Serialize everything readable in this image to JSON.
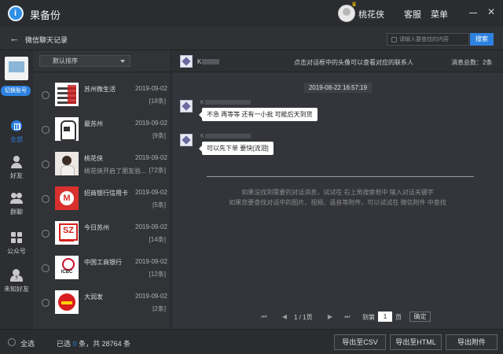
{
  "app": {
    "title": "果备份",
    "logo_glyph": "i",
    "accent": "#2d82e0"
  },
  "titlebar": {
    "user_name": "桃花侠",
    "service": "客服",
    "menu": "菜单",
    "minimize_glyph": "—",
    "close_glyph": "✕",
    "crown_glyph": "♛"
  },
  "subbar": {
    "back_glyph": "←",
    "title": "微信聊天记录",
    "search_placeholder": "请输入要查找的内容",
    "search_button": "搜索"
  },
  "leftnav": {
    "switch_account": "切换账号",
    "items": [
      {
        "label": "全部",
        "icon": "grid-icon",
        "active": true
      },
      {
        "label": "好友",
        "icon": "person-icon"
      },
      {
        "label": "群聊",
        "icon": "group-icon"
      },
      {
        "label": "公众号",
        "icon": "apps-icon"
      },
      {
        "label": "未知好友",
        "icon": "unknown-person-icon"
      }
    ]
  },
  "list": {
    "sort_label": "默认排序",
    "contacts": [
      {
        "name": "苏州微生活",
        "preview": "",
        "date": "2019-09-02",
        "count": "[18条]"
      },
      {
        "name": "最苏州",
        "preview": "",
        "date": "2019-09-02",
        "count": "[9条]"
      },
      {
        "name": "桃花侠",
        "preview": "桃花侠开启了朋友验...",
        "date": "2019-09-02",
        "count": "[72条]"
      },
      {
        "name": "招商银行信用卡",
        "preview": "",
        "date": "2019-09-02",
        "count": "[5条]"
      },
      {
        "name": "今日苏州",
        "preview": "",
        "date": "2019-09-02",
        "count": "[14条]"
      },
      {
        "name": "中国工商银行",
        "preview": "",
        "date": "2019-09-02",
        "count": "[12条]"
      },
      {
        "name": "大润发",
        "preview": "",
        "date": "2019-09-02",
        "count": "[2条]"
      }
    ]
  },
  "chat": {
    "header_name": "K",
    "header_hint": "点击对话框中的头像可以查看对应的联系人",
    "total": "消息总数：2条",
    "time": "2019-08-22 16:57:19",
    "messages": [
      {
        "sender": "K",
        "text": "不急 再等等 还有一小批 可能后天到货"
      },
      {
        "sender": "K",
        "text": "可以先下单 要快[流泪]"
      }
    ],
    "note_line1": "如果没找到需要的对话消息，试试在 右上角搜索框中 输入对话关键字",
    "note_line2": "如果您要查找对话中的图片、视频、语音等附件，可以试试在 微信附件 中查找",
    "pager": {
      "first": "⏮",
      "prev": "◀",
      "next": "▶",
      "last": "⏭",
      "info": "1 / 1页",
      "goto": "到第",
      "value": "1",
      "page": "页",
      "ok": "确定"
    }
  },
  "footer": {
    "select_all": "全选",
    "selected_prefix": "已选",
    "selected_count": "0",
    "selected_suffix": "条，共 28764 条",
    "export_csv": "导出至CSV",
    "export_html": "导出至HTML",
    "export_attach": "导出附件"
  }
}
